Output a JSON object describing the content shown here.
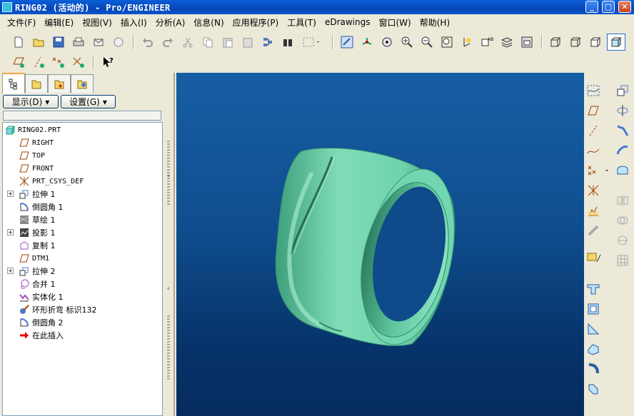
{
  "window": {
    "title": "RING02 (活动的) - Pro/ENGINEER",
    "min_icon": "minimize-icon",
    "max_icon": "maximize-icon",
    "close_icon": "close-icon"
  },
  "menu": [
    "文件(F)",
    "编辑(E)",
    "视图(V)",
    "插入(I)",
    "分析(A)",
    "信息(N)",
    "应用程序(P)",
    "工具(T)",
    "eDrawings",
    "窗口(W)",
    "帮助(H)"
  ],
  "toolbar": {
    "icons": [
      "new-file-icon",
      "open-folder-icon",
      "save-icon",
      "print-icon",
      "send-mail-icon",
      "mail-recipient-icon",
      "undo-icon",
      "redo-icon",
      "cut-icon",
      "copy-icon",
      "paste-icon",
      "paste-special-icon",
      "regenerate-icon",
      "find-binoculars-icon",
      "select-box-icon",
      "repaint-icon",
      "spin-center-icon",
      "orient-mode-icon",
      "zoom-in-icon",
      "zoom-out-icon",
      "refit-icon",
      "reorient-icon",
      "saved-views-icon",
      "layers-icon",
      "view-manager-icon",
      "wireframe-icon",
      "hidden-line-icon",
      "no-hidden-icon",
      "shading-icon"
    ],
    "datum_icons": [
      "datum-plane-display-icon",
      "datum-axis-display-icon",
      "datum-point-display-icon",
      "coordinate-system-display-icon",
      "context-help-icon"
    ]
  },
  "panel": {
    "tabs": [
      "model-tree-tab-icon",
      "folder-browser-tab-icon",
      "favorites-tab-icon",
      "connections-tab-icon"
    ],
    "show_button": "显示(D)",
    "settings_button": "设置(G)",
    "tree": [
      {
        "label": "RING02.PRT",
        "icon": "part-icon",
        "level": 0,
        "expander": false
      },
      {
        "label": "RIGHT",
        "icon": "datum-plane-icon",
        "level": 1,
        "expander": false
      },
      {
        "label": "TOP",
        "icon": "datum-plane-icon",
        "level": 1,
        "expander": false
      },
      {
        "label": "FRONT",
        "icon": "datum-plane-icon",
        "level": 1,
        "expander": false
      },
      {
        "label": "PRT_CSYS_DEF",
        "icon": "coordinate-system-icon",
        "level": 1,
        "expander": false
      },
      {
        "label": "拉伸 1",
        "icon": "extrude-icon",
        "level": 1,
        "expander": true
      },
      {
        "label": "倒圆角 1",
        "icon": "round-icon",
        "level": 1,
        "expander": false
      },
      {
        "label": "草绘 1",
        "icon": "sketch-icon",
        "level": 1,
        "expander": false
      },
      {
        "label": "投影 1",
        "icon": "projection-icon",
        "level": 1,
        "expander": true
      },
      {
        "label": "复制 1",
        "icon": "copy-surface-icon",
        "level": 1,
        "expander": false
      },
      {
        "label": "DTM1",
        "icon": "datum-plane-icon",
        "level": 1,
        "expander": false
      },
      {
        "label": "拉伸 2",
        "icon": "extrude-icon",
        "level": 1,
        "expander": true
      },
      {
        "label": "合并 1",
        "icon": "merge-icon",
        "level": 1,
        "expander": false
      },
      {
        "label": "实体化 1",
        "icon": "solidify-icon",
        "level": 1,
        "expander": false
      },
      {
        "label": "环形折弯 标识132",
        "icon": "toroidal-bend-icon",
        "level": 1,
        "expander": false
      },
      {
        "label": "倒圆角 2",
        "icon": "round-icon",
        "level": 1,
        "expander": false
      },
      {
        "label": "在此插入",
        "icon": "insert-here-arrow-icon",
        "level": 1,
        "expander": false
      }
    ]
  },
  "right_toolbar": {
    "col1": [
      "sketched-datum-curve-icon",
      "datum-plane-tool-icon",
      "datum-axis-tool-icon",
      "datum-curve-tool-icon",
      "datum-point-tool-icon",
      "coordinate-system-tool-icon",
      "analysis-feature-icon",
      "offset-tool-icon",
      "hole-tool-icon",
      "shell-tool-icon",
      "rib-tool-icon",
      "draft-tool-icon",
      "round-tool-icon",
      "chamfer-tool-icon"
    ],
    "col2": [
      "extrude-tool-icon",
      "revolve-tool-icon",
      "sweep-tool-icon",
      "blend-tool-icon",
      "boundary-blend-icon",
      "mirror-tool-icon",
      "merge-tool-icon",
      "trim-tool-icon",
      "pattern-tool-icon"
    ]
  },
  "colors": {
    "model": "#6fd3ad",
    "model_shadow": "#2f8a6a",
    "viewport_top": "#165ea5",
    "viewport_bottom": "#062c5e",
    "title_bar": "#0a54cc"
  }
}
